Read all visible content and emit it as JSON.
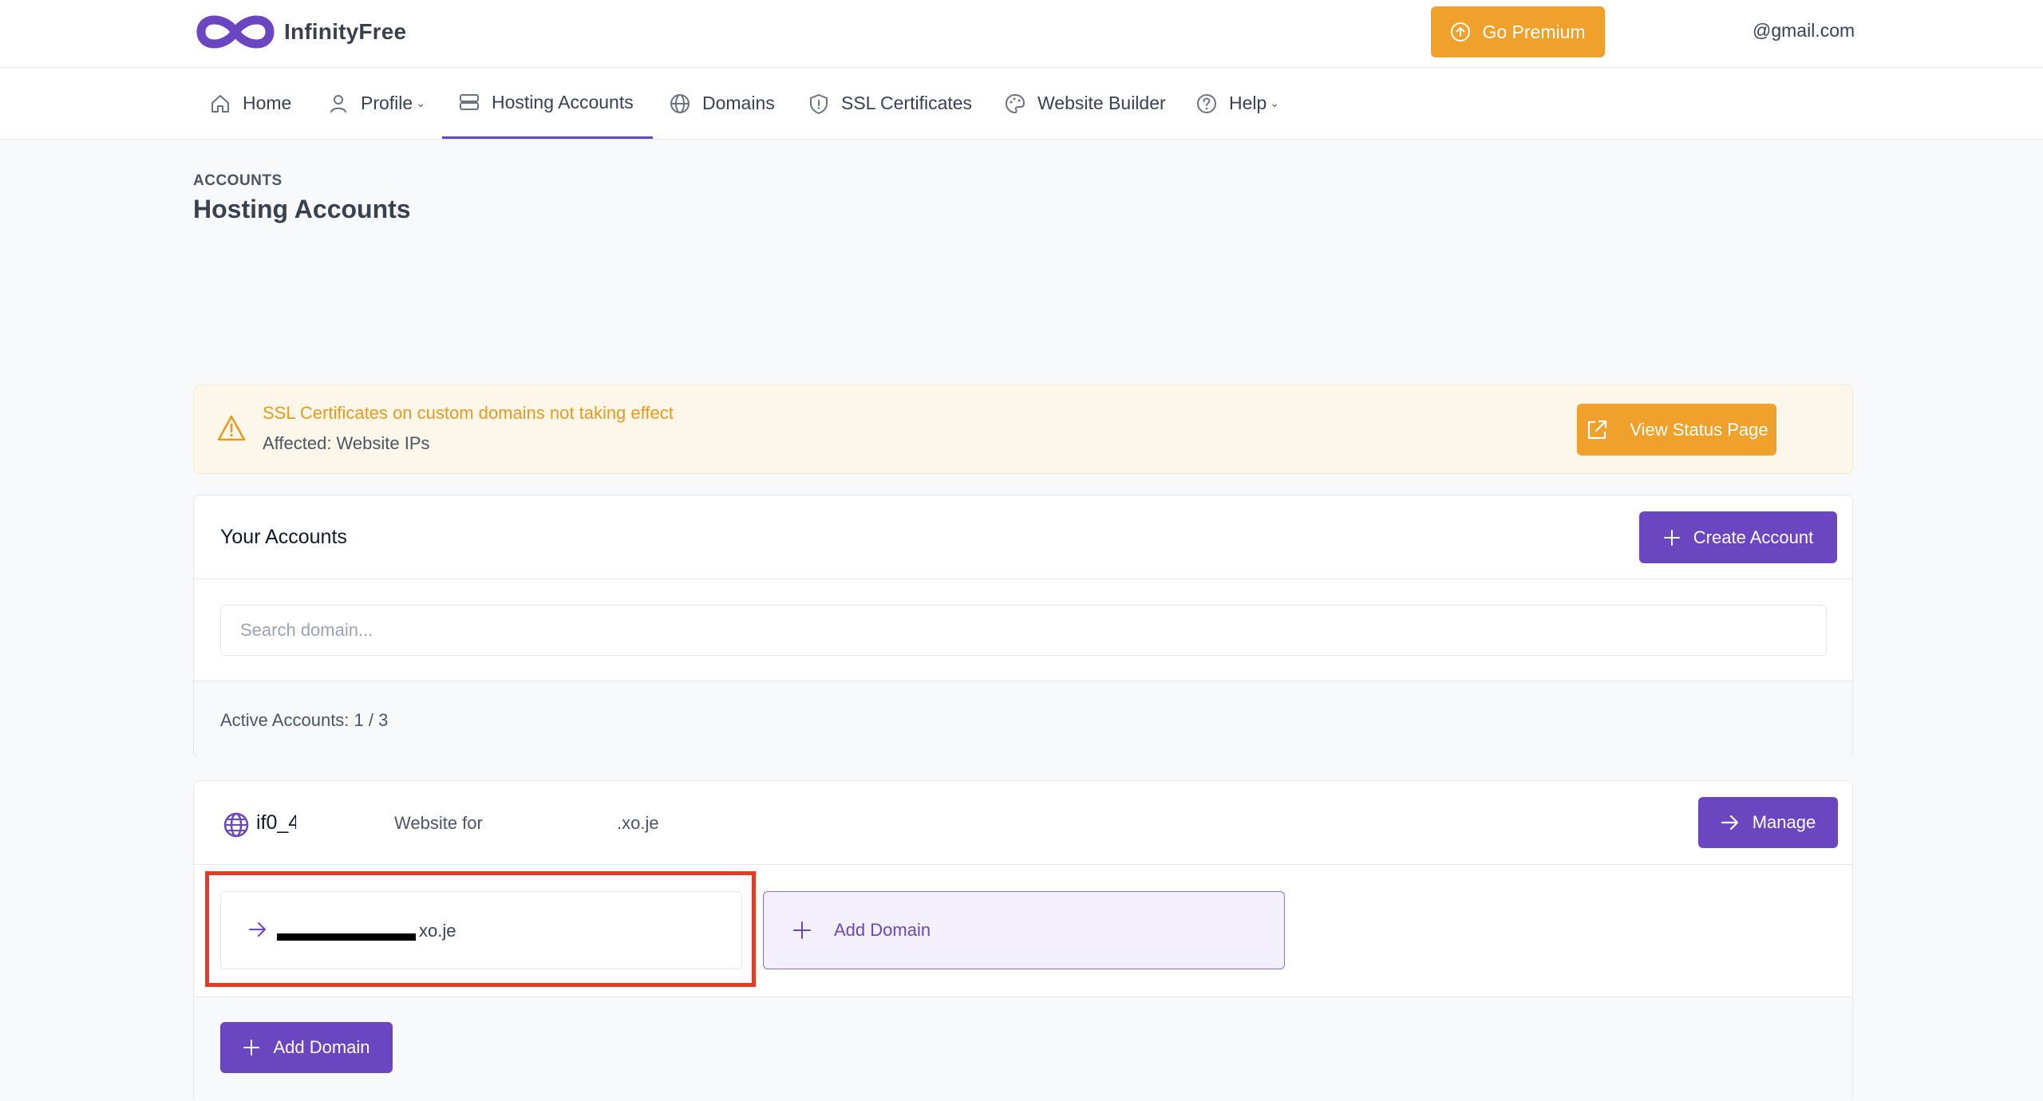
{
  "app": {
    "brand": "InfinityFree"
  },
  "header": {
    "premium_label": "Go Premium",
    "user_email": "@gmail.com"
  },
  "nav": {
    "items": [
      {
        "label": "Home",
        "icon": "home-icon"
      },
      {
        "label": "Profile",
        "icon": "user-icon",
        "has_dropdown": true
      },
      {
        "label": "Hosting Accounts",
        "icon": "server-icon",
        "active": true
      },
      {
        "label": "Domains",
        "icon": "globe-icon"
      },
      {
        "label": "SSL Certificates",
        "icon": "shield-icon"
      },
      {
        "label": "Website Builder",
        "icon": "palette-icon"
      },
      {
        "label": "Help",
        "icon": "help-circle-icon",
        "has_dropdown": true
      }
    ]
  },
  "page": {
    "breadcrumb": "ACCOUNTS",
    "title": "Hosting Accounts"
  },
  "alert": {
    "title": "SSL Certificates on custom domains not taking effect",
    "subtitle": "Affected: Website IPs",
    "button_label": "View Status Page"
  },
  "accounts_card": {
    "title": "Your Accounts",
    "create_label": "Create Account",
    "search_placeholder": "Search domain...",
    "active_count": "Active Accounts: 1 / 3"
  },
  "account": {
    "id": "if0_4",
    "label": "Website for",
    "domain": ".xo.je",
    "manage_label": "Manage",
    "domains": [
      {
        "suffix": "xo.je",
        "redacted": true
      }
    ],
    "add_domain_tile_label": "Add Domain",
    "add_domain_button_label": "Add Domain"
  },
  "colors": {
    "primary": "#6b46c1",
    "warning": "#f0a12b",
    "alert_bg": "#fdf7e9",
    "highlight": "#e23c28"
  }
}
